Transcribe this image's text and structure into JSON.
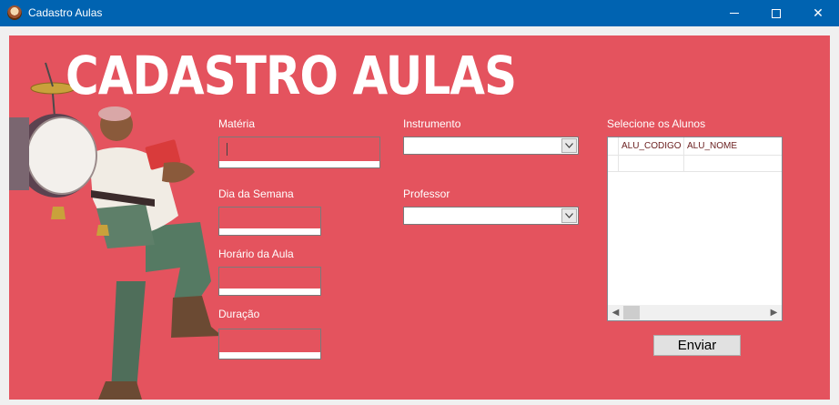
{
  "window": {
    "title": "Cadastro Aulas",
    "controls": {
      "minimize": "minimize",
      "maximize": "maximize",
      "close": "✕"
    }
  },
  "header": {
    "title": "CADASTRO AULAS"
  },
  "form": {
    "materia_label": "Matéria",
    "dia_label": "Dia da Semana",
    "horario_label": "Horário da Aula",
    "duracao_label": "Duração",
    "instrumento_label": "Instrumento",
    "professor_label": "Professor",
    "alunos_label": "Selecione os Alunos"
  },
  "grid": {
    "columns": [
      "ALU_CODIGO",
      "ALU_NOME"
    ],
    "rows": [
      [
        "",
        ""
      ]
    ]
  },
  "actions": {
    "submit_label": "Enviar"
  },
  "colors": {
    "background": "#e4535e",
    "titlebar": "#0063b1",
    "text": "#ffffff"
  }
}
